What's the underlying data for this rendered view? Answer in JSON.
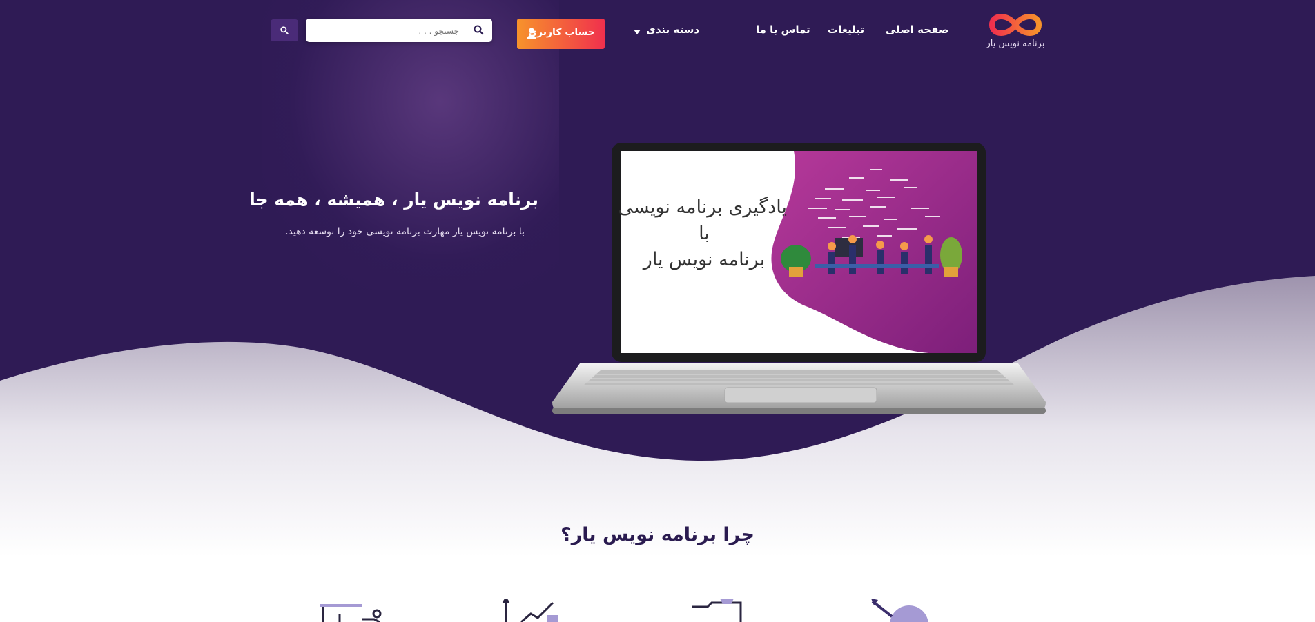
{
  "brand": {
    "logo_text": "برنامه نویس یار"
  },
  "nav": {
    "home": "صفحه اصلی",
    "ads": "تبلیغات",
    "contact": "تماس با ما",
    "categories": "دسته بندی",
    "account_button": "حساب کاربری"
  },
  "search": {
    "placeholder": "جستجو . . ."
  },
  "hero": {
    "title": "برنامه نویس یار ، همیشه ، همه جا",
    "subtitle": "با برنامه نویس یار مهارت برنامه نویسی خود را توسعه دهید.",
    "screen_line1": "یادگیری برنامه نویسی",
    "screen_line2": "با",
    "screen_line3": "برنامه نویس یار"
  },
  "section": {
    "title": "چرا برنامه نویس یار؟"
  },
  "icons": [
    "logo-infinity-icon",
    "search-icon",
    "user-icon",
    "caret-down-icon",
    "target-icon",
    "folder-icon",
    "growth-chart-icon",
    "presentation-icon"
  ],
  "colors": {
    "hero_bg": "#2f1b55",
    "accent_start": "#f7932b",
    "accent_end": "#f0304d",
    "search_btn": "#4a2b78",
    "screen_bg": "#a8318f"
  }
}
